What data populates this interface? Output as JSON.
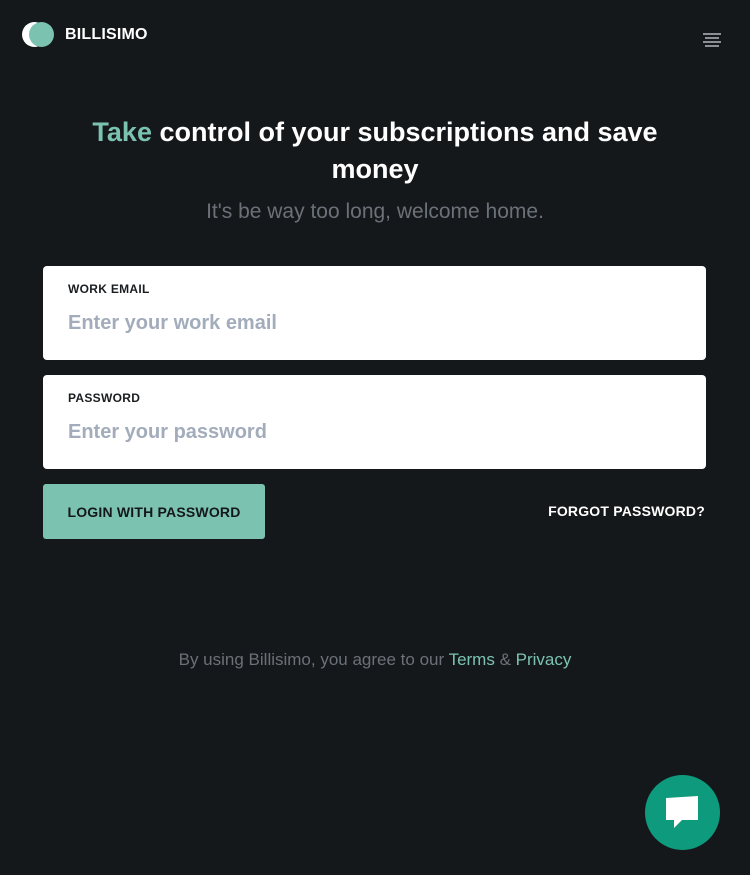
{
  "header": {
    "brand": "BILLISIMO",
    "logo_icon": "billisimo-logo",
    "menu_icon": "hamburger-menu-icon"
  },
  "hero": {
    "headline_accent": "Take",
    "headline_rest": " control of your subscriptions and save money",
    "subtitle": "It's be way too long, welcome home."
  },
  "form": {
    "email": {
      "label": "WORK EMAIL",
      "placeholder": "Enter your work email",
      "value": ""
    },
    "password": {
      "label": "PASSWORD",
      "placeholder": "Enter your password",
      "value": ""
    },
    "login_label": "LOGIN WITH PASSWORD",
    "forgot_label": "FORGOT PASSWORD?"
  },
  "legal": {
    "prefix": "By using Billisimo, you agree to our ",
    "terms": "Terms",
    "amp": " & ",
    "privacy": "Privacy"
  },
  "chat": {
    "icon": "chat-bubble-icon"
  },
  "colors": {
    "background": "#15181b",
    "accent": "#7bc3b0",
    "chat": "#0e9a7c",
    "muted_text": "#6b7178"
  }
}
